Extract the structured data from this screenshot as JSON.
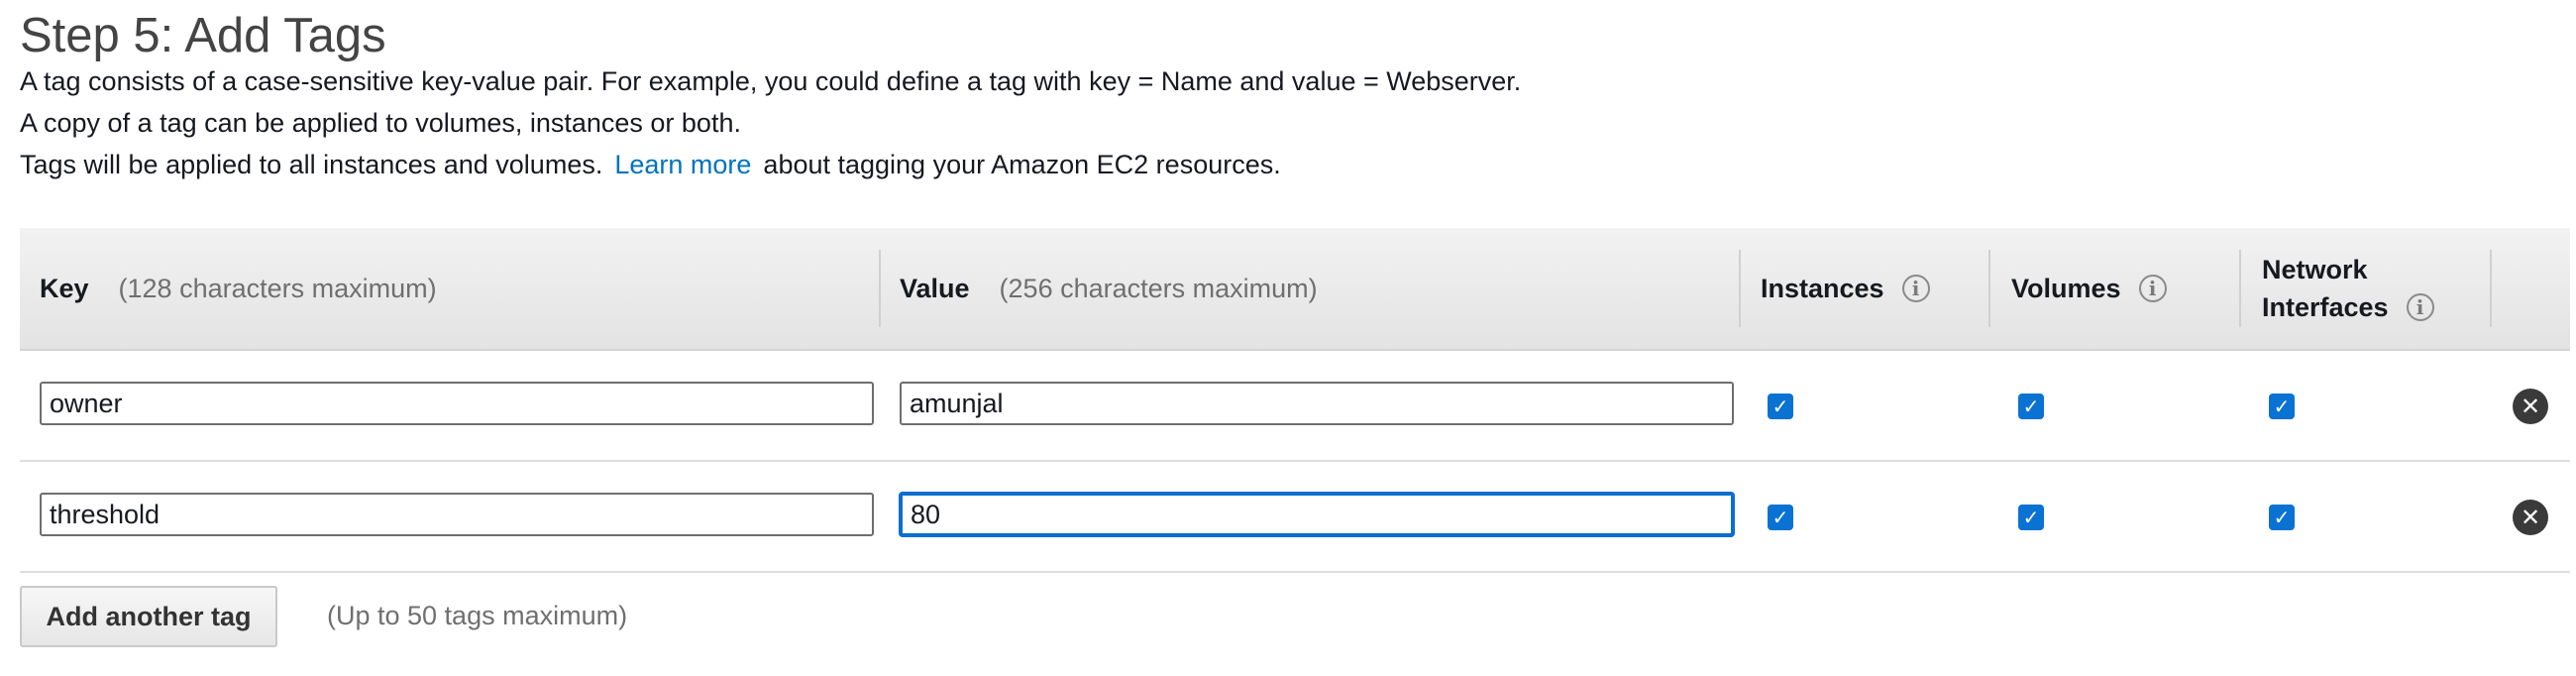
{
  "header": {
    "title": "Step 5: Add Tags",
    "line1": "A tag consists of a case-sensitive key-value pair. For example, you could define a tag with key = Name and value = Webserver.",
    "line2": "A copy of a tag can be applied to volumes, instances or both.",
    "line3_prefix": "Tags will be applied to all instances and volumes.",
    "learn_more": "Learn more",
    "line3_suffix": "about tagging your Amazon EC2 resources."
  },
  "table": {
    "columns": {
      "key": "Key",
      "key_hint": "(128 characters maximum)",
      "value": "Value",
      "value_hint": "(256 characters maximum)",
      "instances": "Instances",
      "volumes": "Volumes",
      "network_line1": "Network",
      "network_line2": "Interfaces",
      "info_glyph": "i"
    },
    "rows": [
      {
        "key": "owner",
        "value": "amunjal",
        "instances": true,
        "volumes": true,
        "network_interfaces": true
      },
      {
        "key": "threshold",
        "value": "80",
        "instances": true,
        "volumes": true,
        "network_interfaces": true
      }
    ],
    "checkmark": "✓",
    "remove_glyph": "✕"
  },
  "footer": {
    "add_button": "Add another tag",
    "limit_hint": "(Up to 50 tags maximum)"
  },
  "colors": {
    "link": "#0073bb",
    "checkbox": "#0972d3",
    "focus_border": "#0a6ed1"
  }
}
